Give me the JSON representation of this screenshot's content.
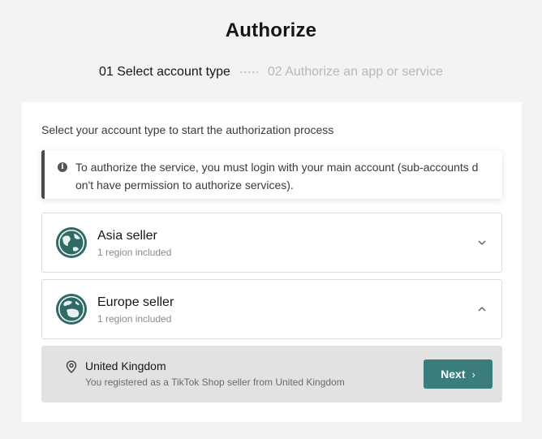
{
  "header": {
    "title": "Authorize"
  },
  "steps": {
    "step1": "01 Select account type",
    "step2": "02 Authorize an app or service"
  },
  "card": {
    "intro": "Select your account type to start the authorization process",
    "notice": "To authorize the service, you must login with your main account (sub-accounts don't have permission to authorize services)."
  },
  "regions": [
    {
      "title": "Asia seller",
      "subtitle": "1 region included",
      "expanded": false,
      "icon": "globe-icon"
    },
    {
      "title": "Europe seller",
      "subtitle": "1 region included",
      "expanded": true,
      "icon": "globe-icon"
    }
  ],
  "country": {
    "name": "United Kingdom",
    "description": "You registered as a TikTok Shop seller from United Kingdom",
    "icon": "location-pin-icon",
    "next_label": "Next"
  },
  "colors": {
    "accent": "#3b7d7c",
    "globe": "#2f6b66",
    "panel": "#e2e2e2"
  }
}
